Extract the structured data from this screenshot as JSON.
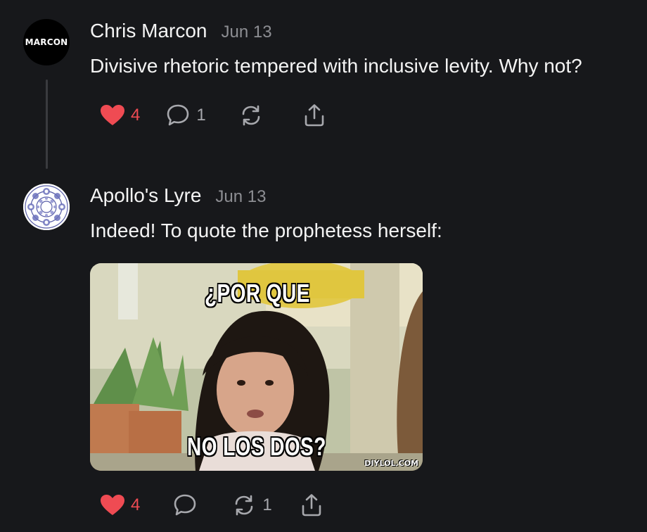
{
  "posts": [
    {
      "avatar_text": "MARCON",
      "author": "Chris Marcon",
      "date": "Jun 13",
      "text": "Divisive rhetoric tempered with inclusive levity. Why not?",
      "likes": "4",
      "comments": "1",
      "restacks": "",
      "liked": true
    },
    {
      "author": "Apollo's Lyre",
      "date": "Jun 13",
      "text": "Indeed! To quote the prophetess herself:",
      "likes": "4",
      "comments": "",
      "restacks": "1",
      "liked": true,
      "image": {
        "caption_top": "¿POR QUE",
        "caption_bottom": "NO LOS DOS?",
        "watermark": "DIYLOL.COM"
      }
    }
  ],
  "colors": {
    "background": "#17181b",
    "like": "#ef4b53",
    "muted": "#8d8e93",
    "text": "#f4f4f4"
  },
  "icons": [
    "heart-icon",
    "comment-icon",
    "restack-icon",
    "share-icon"
  ]
}
